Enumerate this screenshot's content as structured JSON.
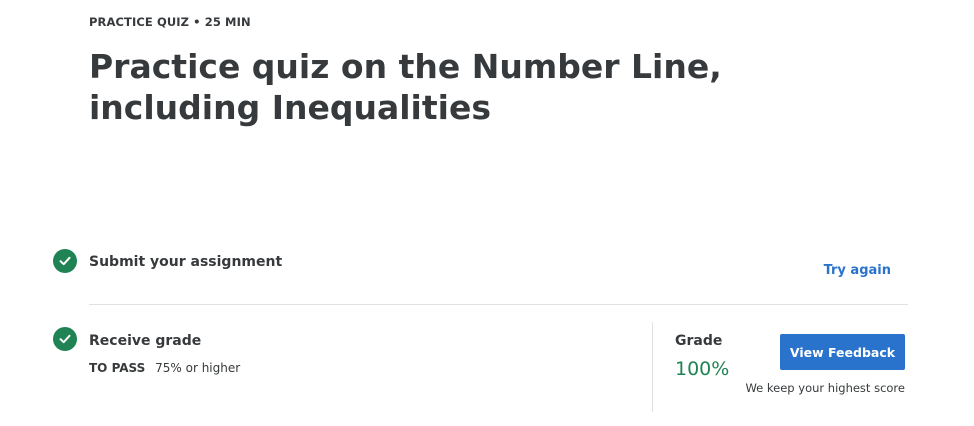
{
  "header": {
    "eyebrow": "PRACTICE QUIZ • 25 MIN",
    "title": "Practice quiz on the Number Line, including Inequalities"
  },
  "steps": {
    "submit": {
      "label": "Submit your assignment",
      "icon": "check-circle-icon",
      "action_label": "Try again"
    },
    "receive": {
      "label": "Receive grade",
      "icon": "check-circle-icon",
      "pass_key": "TO PASS",
      "pass_value": "75% or higher"
    }
  },
  "grade": {
    "label": "Grade",
    "value": "100%",
    "button_label": "View Feedback",
    "note": "We keep your highest score"
  },
  "colors": {
    "success": "#1f8354",
    "primary": "#2a73cc",
    "text": "#373a3c",
    "divider": "#e1e1e1"
  }
}
